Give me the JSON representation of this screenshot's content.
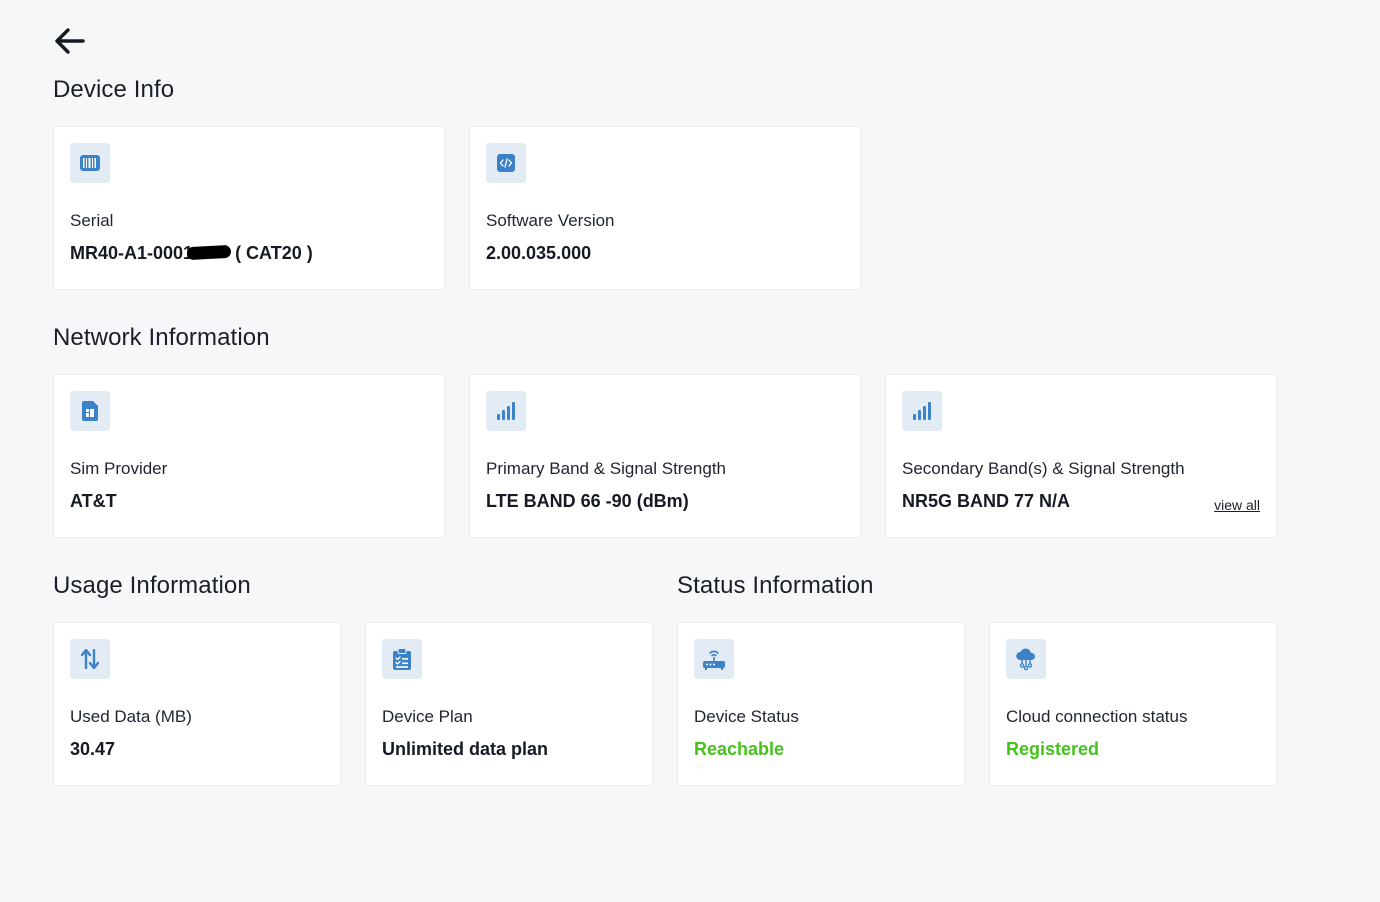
{
  "sections": {
    "device_info": "Device Info",
    "network_info": "Network Information",
    "usage_info": "Usage Information",
    "status_info": "Status Information"
  },
  "device": {
    "serial_label": "Serial",
    "serial_value_prefix": "MR40-A1-0001",
    "serial_value_suffix": "( CAT20 )",
    "software_label": "Software Version",
    "software_value": "2.00.035.000"
  },
  "network": {
    "sim_label": "Sim Provider",
    "sim_value": "AT&T",
    "primary_label": "Primary Band & Signal Strength",
    "primary_value": "LTE BAND 66 -90 (dBm)",
    "secondary_label": "Secondary Band(s) & Signal Strength",
    "secondary_value": "NR5G BAND 77 N/A",
    "view_all": "view all"
  },
  "usage": {
    "used_label": "Used Data (MB)",
    "used_value": "30.47",
    "plan_label": "Device Plan",
    "plan_value": "Unlimited data plan"
  },
  "status": {
    "device_label": "Device Status",
    "device_value": "Reachable",
    "cloud_label": "Cloud connection status",
    "cloud_value": "Registered"
  },
  "icons": {
    "back": "arrow-left-icon",
    "serial": "barcode-icon",
    "software": "code-icon",
    "sim": "sim-card-icon",
    "primary": "signal-bars-icon",
    "secondary": "signal-bars-icon",
    "used": "data-transfer-icon",
    "plan": "clipboard-list-icon",
    "device_status": "router-icon",
    "cloud": "cloud-network-icon"
  },
  "colors": {
    "background": "#f6f7f9",
    "icon_accent": "#3b82c8",
    "icon_bg": "#e3ebf5",
    "status_ok": "#46c21c"
  }
}
